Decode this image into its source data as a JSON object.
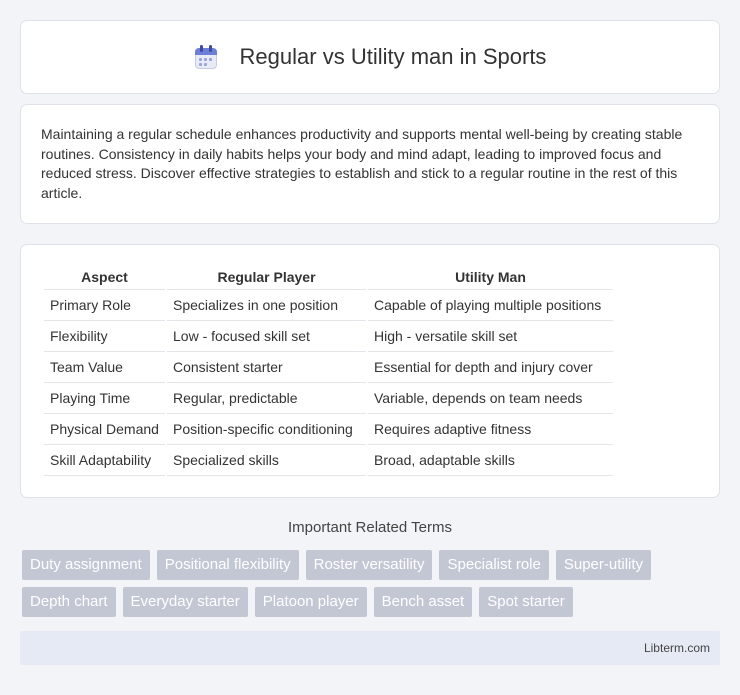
{
  "header": {
    "icon": "calendar-icon",
    "title": "Regular vs Utility man in Sports"
  },
  "intro": {
    "text": "Maintaining a regular schedule enhances productivity and supports mental well-being by creating stable routines. Consistency in daily habits helps your body and mind adapt, leading to improved focus and reduced stress. Discover effective strategies to establish and stick to a regular routine in the rest of this article."
  },
  "table": {
    "headers": [
      "Aspect",
      "Regular Player",
      "Utility Man"
    ],
    "rows": [
      [
        "Primary Role",
        "Specializes in one position",
        "Capable of playing multiple positions"
      ],
      [
        "Flexibility",
        "Low - focused skill set",
        "High - versatile skill set"
      ],
      [
        "Team Value",
        "Consistent starter",
        "Essential for depth and injury cover"
      ],
      [
        "Playing Time",
        "Regular, predictable",
        "Variable, depends on team needs"
      ],
      [
        "Physical Demand",
        "Position-specific conditioning",
        "Requires adaptive fitness"
      ],
      [
        "Skill Adaptability",
        "Specialized skills",
        "Broad, adaptable skills"
      ]
    ]
  },
  "terms": {
    "title": "Important Related Terms",
    "row1": [
      "Duty assignment",
      "Positional flexibility",
      "Roster versatility",
      "Specialist role",
      "Super-utility"
    ],
    "row2": [
      "Depth chart",
      "Everyday starter",
      "Platoon player",
      "Bench asset",
      "Spot starter"
    ]
  },
  "footer": {
    "brand": "Libterm.com"
  },
  "colors": {
    "tag_bg": "#c3c7d3",
    "footer_bg": "#e6eaf5",
    "page_bg": "#f3f4f7"
  }
}
